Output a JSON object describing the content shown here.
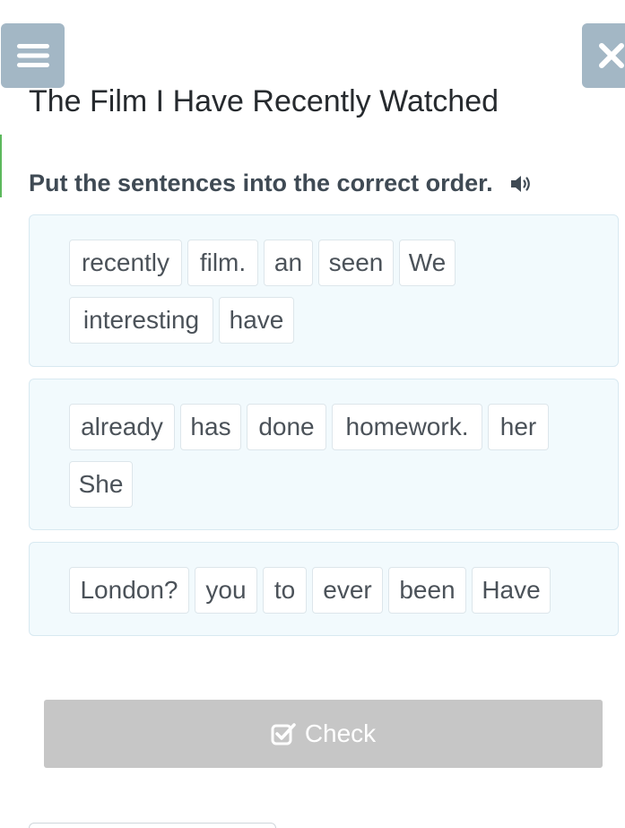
{
  "header": {
    "menu_icon": "hamburger-icon",
    "close_icon": "close-icon",
    "button_color": "#a3b7c5"
  },
  "title": "The Film I Have Recently Watched",
  "instruction": {
    "text": "Put the sentences into the correct order.",
    "audio_icon": "speaker-icon"
  },
  "sentences": [
    {
      "words": [
        "recently",
        "film.",
        "an",
        "seen",
        "We",
        "interesting",
        "have"
      ]
    },
    {
      "words": [
        "already",
        "has",
        "done",
        "homework.",
        "her",
        "She"
      ]
    },
    {
      "words": [
        "London?",
        "you",
        "to",
        "ever",
        "been",
        "Have"
      ]
    }
  ],
  "check_button": {
    "label": "Check",
    "icon": "checkbox-check-icon",
    "enabled": false,
    "color": "#c6c6c6"
  }
}
